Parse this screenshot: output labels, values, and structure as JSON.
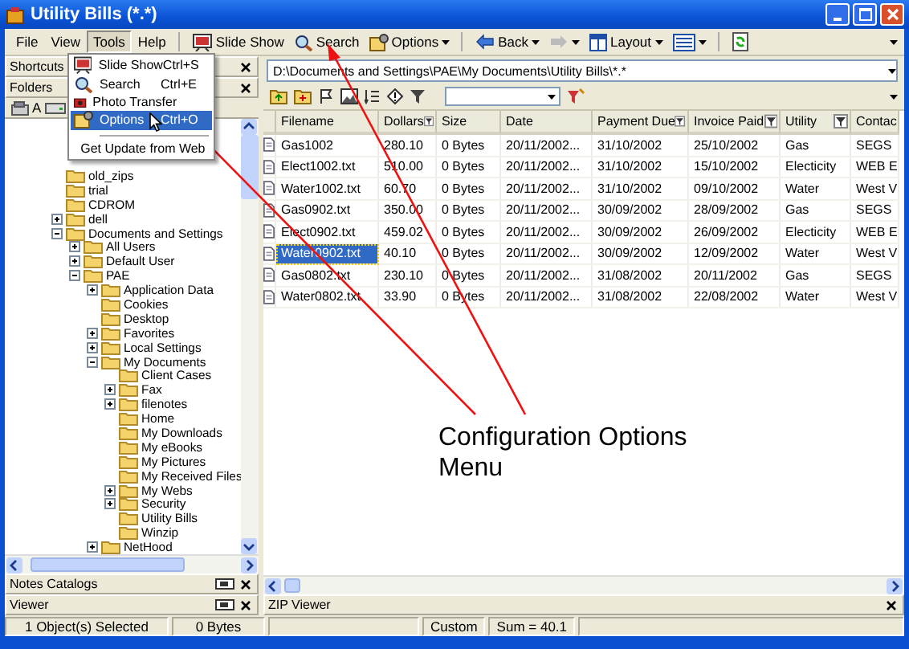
{
  "window": {
    "title": "Utility Bills (*.*)"
  },
  "menu_bar": [
    {
      "label": "File",
      "selected": false
    },
    {
      "label": "View",
      "selected": false
    },
    {
      "label": "Tools",
      "selected": true
    },
    {
      "label": "Help",
      "selected": false
    }
  ],
  "toolbar": [
    {
      "kind": "slideshow",
      "label": "Slide Show"
    },
    {
      "kind": "search",
      "label": "Search"
    },
    {
      "kind": "options",
      "label": "Options"
    },
    {
      "kind": "back",
      "label": "Back"
    },
    {
      "kind": "forward"
    },
    {
      "kind": "layout",
      "label": "Layout"
    },
    {
      "kind": "views"
    },
    {
      "kind": "sync"
    }
  ],
  "tools_menu": [
    {
      "kind": "item",
      "label": "Slide Show",
      "shortcut": "Ctrl+S",
      "selected": false
    },
    {
      "kind": "item",
      "label": "Search",
      "shortcut": "Ctrl+E",
      "selected": false
    },
    {
      "kind": "item",
      "label": "Photo Transfer",
      "selected": false
    },
    {
      "kind": "item",
      "label": "Options",
      "shortcut": "Ctrl+O",
      "selected": true
    },
    {
      "kind": "separator"
    },
    {
      "kind": "item",
      "label": "Get Update from Web",
      "selected": false
    }
  ],
  "left_pane": {
    "panels": [
      {
        "title": "Shortcuts"
      },
      {
        "title": "Folders"
      }
    ],
    "drive_label": "A",
    "tree": [
      {
        "label": "old_zips",
        "expandable": false
      },
      {
        "label": "trial",
        "expandable": false
      },
      {
        "label": "CDROM",
        "expandable": false
      },
      {
        "label": "dell",
        "expandable": true,
        "expanded": false
      },
      {
        "label": "Documents and Settings",
        "expandable": true,
        "expanded": true,
        "children": [
          {
            "label": "All Users",
            "expandable": true,
            "expanded": false
          },
          {
            "label": "Default User",
            "expandable": true,
            "expanded": false
          },
          {
            "label": "PAE",
            "expandable": true,
            "expanded": true,
            "children": [
              {
                "label": "Application Data",
                "expandable": true,
                "expanded": false
              },
              {
                "label": "Cookies",
                "expandable": false
              },
              {
                "label": "Desktop",
                "expandable": false
              },
              {
                "label": "Favorites",
                "expandable": true,
                "expanded": false
              },
              {
                "label": "Local Settings",
                "expandable": true,
                "expanded": false
              },
              {
                "label": "My Documents",
                "expandable": true,
                "expanded": true,
                "children": [
                  {
                    "label": "Client Cases",
                    "expandable": false
                  },
                  {
                    "label": "Fax",
                    "expandable": true,
                    "expanded": false
                  },
                  {
                    "label": "filenotes",
                    "expandable": true,
                    "expanded": false
                  },
                  {
                    "label": "Home",
                    "expandable": false
                  },
                  {
                    "label": "My Downloads",
                    "expandable": false
                  },
                  {
                    "label": "My eBooks",
                    "expandable": false
                  },
                  {
                    "label": "My Pictures",
                    "expandable": false
                  },
                  {
                    "label": "My Received Files",
                    "expandable": false
                  },
                  {
                    "label": "My Webs",
                    "expandable": true,
                    "expanded": false
                  },
                  {
                    "label": "Security",
                    "expandable": true,
                    "expanded": false
                  },
                  {
                    "label": "Utility Bills",
                    "expandable": false
                  },
                  {
                    "label": "Winzip",
                    "expandable": false
                  }
                ]
              },
              {
                "label": "NetHood",
                "expandable": true,
                "expanded": false
              }
            ]
          }
        ]
      }
    ],
    "bottom_panels": [
      {
        "title": "Notes Catalogs"
      },
      {
        "title": "Viewer"
      }
    ]
  },
  "right_pane": {
    "address": "D:\\Documents and Settings\\PAE\\My Documents\\Utility Bills\\*.*",
    "table": {
      "columns": [
        {
          "label": "Filename",
          "filter": false
        },
        {
          "label": "Dollars",
          "filter": true
        },
        {
          "label": "Size",
          "filter": false
        },
        {
          "label": "Date",
          "filter": false
        },
        {
          "label": "Payment Due",
          "filter": true
        },
        {
          "label": "Invoice Paid",
          "filter": true
        },
        {
          "label": "Utility",
          "filter": true
        },
        {
          "label": "Contac"
        }
      ],
      "rows": [
        {
          "selected": false,
          "cells": [
            "Gas1002",
            "280.10",
            "0 Bytes",
            "20/11/2002...",
            "31/10/2002",
            "25/10/2002",
            "Gas",
            "SEGS"
          ]
        },
        {
          "selected": false,
          "cells": [
            "Elect1002.txt",
            "510.00",
            "0 Bytes",
            "20/11/2002...",
            "31/10/2002",
            "15/10/2002",
            "Electicity",
            "WEB E"
          ]
        },
        {
          "selected": false,
          "cells": [
            "Water1002.txt",
            "60.70",
            "0 Bytes",
            "20/11/2002...",
            "31/10/2002",
            "09/10/2002",
            "Water",
            "West V"
          ]
        },
        {
          "selected": false,
          "cells": [
            "Gas0902.txt",
            "350.00",
            "0 Bytes",
            "20/11/2002...",
            "30/09/2002",
            "28/09/2002",
            "Gas",
            "SEGS"
          ]
        },
        {
          "selected": false,
          "cells": [
            "Elect0902.txt",
            "459.02",
            "0 Bytes",
            "20/11/2002...",
            "30/09/2002",
            "26/09/2002",
            "Electicity",
            "WEB E"
          ]
        },
        {
          "selected": true,
          "cells": [
            "Water0902.txt",
            "40.10",
            "0 Bytes",
            "20/11/2002...",
            "30/09/2002",
            "12/09/2002",
            "Water",
            "West V"
          ]
        },
        {
          "selected": false,
          "cells": [
            "Gas0802.txt",
            "230.10",
            "0 Bytes",
            "20/11/2002...",
            "31/08/2002",
            "20/11/2002",
            "Gas",
            "SEGS"
          ]
        },
        {
          "selected": false,
          "cells": [
            "Water0802.txt",
            "33.90",
            "0 Bytes",
            "20/11/2002...",
            "31/08/2002",
            "22/08/2002",
            "Water",
            "West V"
          ]
        }
      ]
    },
    "bottom_panel": {
      "title": "ZIP Viewer"
    }
  },
  "status_bar": [
    "1 Object(s) Selected",
    "0 Bytes",
    "Custom",
    "Sum = 40.1"
  ],
  "annotation": {
    "text": "Configuration Options Menu"
  }
}
